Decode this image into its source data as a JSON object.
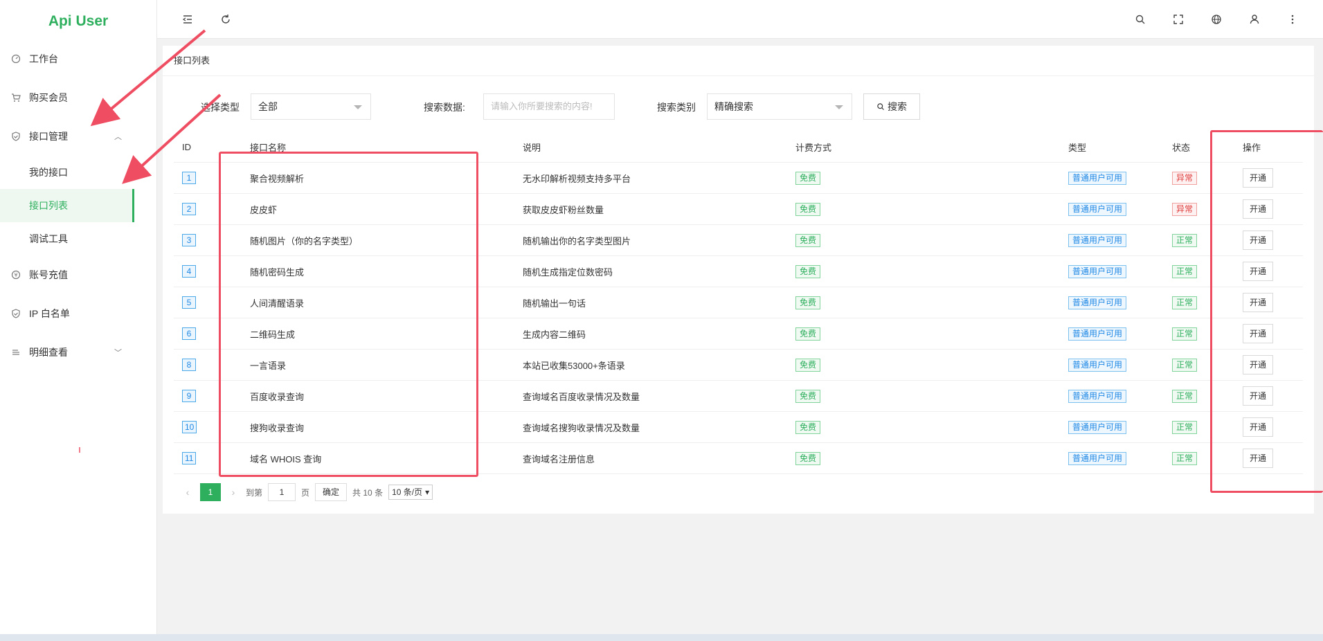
{
  "app": {
    "title": "Api User"
  },
  "sidebar": {
    "items": [
      {
        "label": "工作台",
        "icon": "dashboard-icon"
      },
      {
        "label": "购买会员",
        "icon": "cart-icon"
      },
      {
        "label": "接口管理",
        "icon": "shield-icon",
        "expanded": true,
        "children": [
          {
            "label": "我的接口"
          },
          {
            "label": "接口列表",
            "active": true
          },
          {
            "label": "调试工具"
          }
        ]
      },
      {
        "label": "账号充值",
        "icon": "yen-icon"
      },
      {
        "label": "IP 白名单",
        "icon": "shield-icon"
      },
      {
        "label": "明细查看",
        "icon": "list-icon",
        "expanded": false
      }
    ]
  },
  "header": {
    "left_icons": [
      "menu-fold-icon",
      "refresh-icon"
    ],
    "right_icons": [
      "search-icon",
      "fullscreen-icon",
      "globe-icon",
      "user-icon",
      "more-vertical-icon"
    ]
  },
  "page": {
    "card_title": "接口列表",
    "filter": {
      "type_label": "选择类型",
      "type_value": "全部",
      "search_label": "搜索数据:",
      "search_placeholder": "请输入你所要搜索的内容!",
      "category_label": "搜索类别",
      "category_value": "精确搜索",
      "search_button": "搜索"
    },
    "table": {
      "headers": {
        "id": "ID",
        "name": "接口名称",
        "desc": "说明",
        "billing": "计费方式",
        "type": "类型",
        "status": "状态",
        "op": "操作"
      },
      "rows": [
        {
          "id": "1",
          "name": "聚合视频解析",
          "desc": "无水印解析视频支持多平台",
          "billing": "免费",
          "type": "普通用户可用",
          "status": "异常",
          "op": "开通"
        },
        {
          "id": "2",
          "name": "皮皮虾",
          "desc": "获取皮皮虾粉丝数量",
          "billing": "免费",
          "type": "普通用户可用",
          "status": "异常",
          "op": "开通"
        },
        {
          "id": "3",
          "name": "随机图片（你的名字类型）",
          "desc": "随机输出你的名字类型图片",
          "billing": "免费",
          "type": "普通用户可用",
          "status": "正常",
          "op": "开通"
        },
        {
          "id": "4",
          "name": "随机密码生成",
          "desc": "随机生成指定位数密码",
          "billing": "免费",
          "type": "普通用户可用",
          "status": "正常",
          "op": "开通"
        },
        {
          "id": "5",
          "name": "人间清醒语录",
          "desc": "随机输出一句话",
          "billing": "免费",
          "type": "普通用户可用",
          "status": "正常",
          "op": "开通"
        },
        {
          "id": "6",
          "name": "二维码生成",
          "desc": "生成内容二维码",
          "billing": "免费",
          "type": "普通用户可用",
          "status": "正常",
          "op": "开通"
        },
        {
          "id": "8",
          "name": "一言语录",
          "desc": "本站已收集53000+条语录",
          "billing": "免费",
          "type": "普通用户可用",
          "status": "正常",
          "op": "开通"
        },
        {
          "id": "9",
          "name": "百度收录查询",
          "desc": "查询域名百度收录情况及数量",
          "billing": "免费",
          "type": "普通用户可用",
          "status": "正常",
          "op": "开通"
        },
        {
          "id": "10",
          "name": "搜狗收录查询",
          "desc": "查询域名搜狗收录情况及数量",
          "billing": "免费",
          "type": "普通用户可用",
          "status": "正常",
          "op": "开通"
        },
        {
          "id": "11",
          "name": "域名 WHOIS 查询",
          "desc": "查询域名注册信息",
          "billing": "免费",
          "type": "普通用户可用",
          "status": "正常",
          "op": "开通"
        }
      ]
    },
    "pagination": {
      "current": "1",
      "goto_label": "到第",
      "goto_value": "1",
      "page_unit": "页",
      "confirm": "确定",
      "total": "共 10 条",
      "page_size": "10 条/页"
    }
  },
  "colors": {
    "accent": "#2eaf5d",
    "annotation": "#ee4d62",
    "info": "#1e88e5",
    "danger": "#e03b3b"
  }
}
